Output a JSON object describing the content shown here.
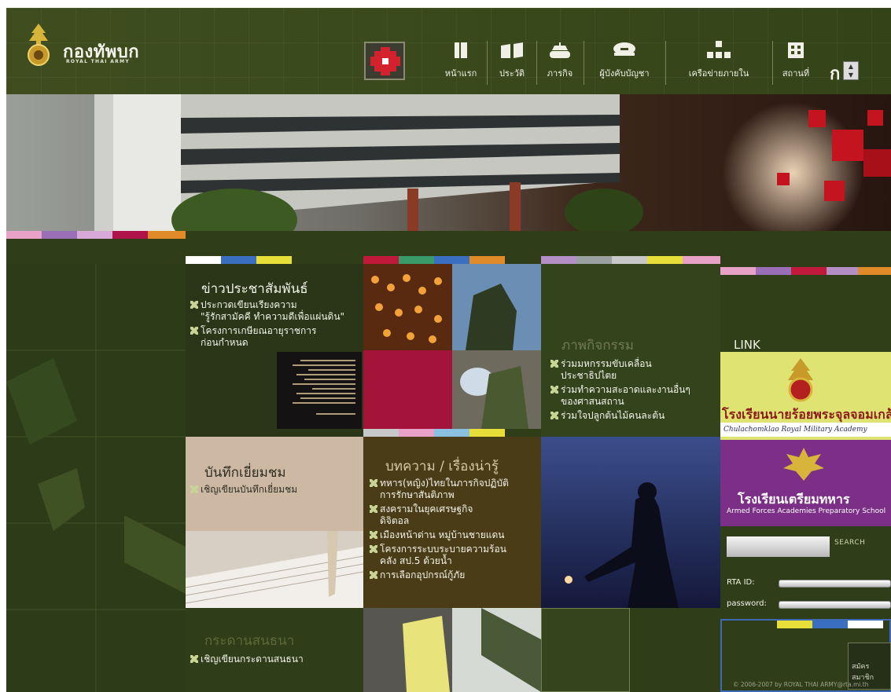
{
  "header": {
    "logo_title": "กองทัพบก",
    "logo_subtitle": "ROYAL THAI ARMY",
    "nav": [
      {
        "label": "หน้าแรก",
        "icon": "book-icon"
      },
      {
        "label": "ประวัติ",
        "icon": "history-book-icon"
      },
      {
        "label": "ภารกิจ",
        "icon": "tank-icon"
      },
      {
        "label": "ผู้บังคับบัญชา",
        "icon": "officer-cap-icon"
      },
      {
        "label": "เครือข่ายภายใน",
        "icon": "network-icon"
      },
      {
        "label": "สถานที่",
        "icon": "building-icon"
      }
    ],
    "font_size_label": "ก",
    "font_up": "▲",
    "font_down": "▼"
  },
  "news": {
    "title": "ข่าวประชาสัมพันธ์",
    "items": [
      "ประกวดเขียนเรียงความ",
      "\"รู้รักสามัคคี ทำความดีเพื่อแผ่นดิน\"",
      "โครงการเกษียณอายุราชการ",
      "ก่อนกำหนด"
    ]
  },
  "activities": {
    "title": "ภาพกิจกรรม",
    "items": [
      "ร่วมมหกรรมขับเคลื่อน",
      "ประชาธิปไตย",
      "ร่วมทำความสะอาดและงานอื่นๆ",
      "ของศาสนสถาน",
      "ร่วมใจปลูกต้นไม้คนละต้น"
    ]
  },
  "guestbook": {
    "title": "บันทึกเยี่ยมชม",
    "item": "เชิญเขียนบันทึกเยี่ยมชม"
  },
  "articles": {
    "title": "บทความ / เรื่องน่ารู้",
    "items": [
      "ทหาร(หญิง)ไทยในภารกิจปฏิบัติ",
      "การรักษาสันติภาพ",
      "สงครามในยุคเศรษฐกิจ",
      "ดิจิตอล",
      "เมืองหน้าด่าน หมู่บ้านชายแดน",
      "โครงการระบบระบายความร้อน",
      "คลัง สป.5 ด้วยน้ำ",
      "การเลือกอุปกรณ์กู้ภัย"
    ]
  },
  "forum": {
    "title": "กระดานสนธนา",
    "item": "เชิญเขียนกระดานสนธนา"
  },
  "links": {
    "label": "LINK",
    "school1_name": "โรงเรียนนายร้อยพระจุลจอมเกล้า",
    "school1_en": "Chulachomklao Royal Military Academy",
    "school2_name": "โรงเรียนเตรียมทหาร",
    "school2_en": "Armed Forces Academies Preparatory School"
  },
  "search": {
    "button": "SEARCH",
    "placeholder": ""
  },
  "login": {
    "id_label": "RTA ID:",
    "password_label": "password:"
  },
  "member_button": "สมัครสมาชิก",
  "copyright": "© 2006-2007 by ROYAL THAI ARMY@rta.mi.th",
  "colors": {
    "background": "#2f3d18",
    "header": "#3c4a1d",
    "accent_red": "#c4192b",
    "school1_bg": "#dfe372",
    "school2_bg": "#7c2f86"
  }
}
